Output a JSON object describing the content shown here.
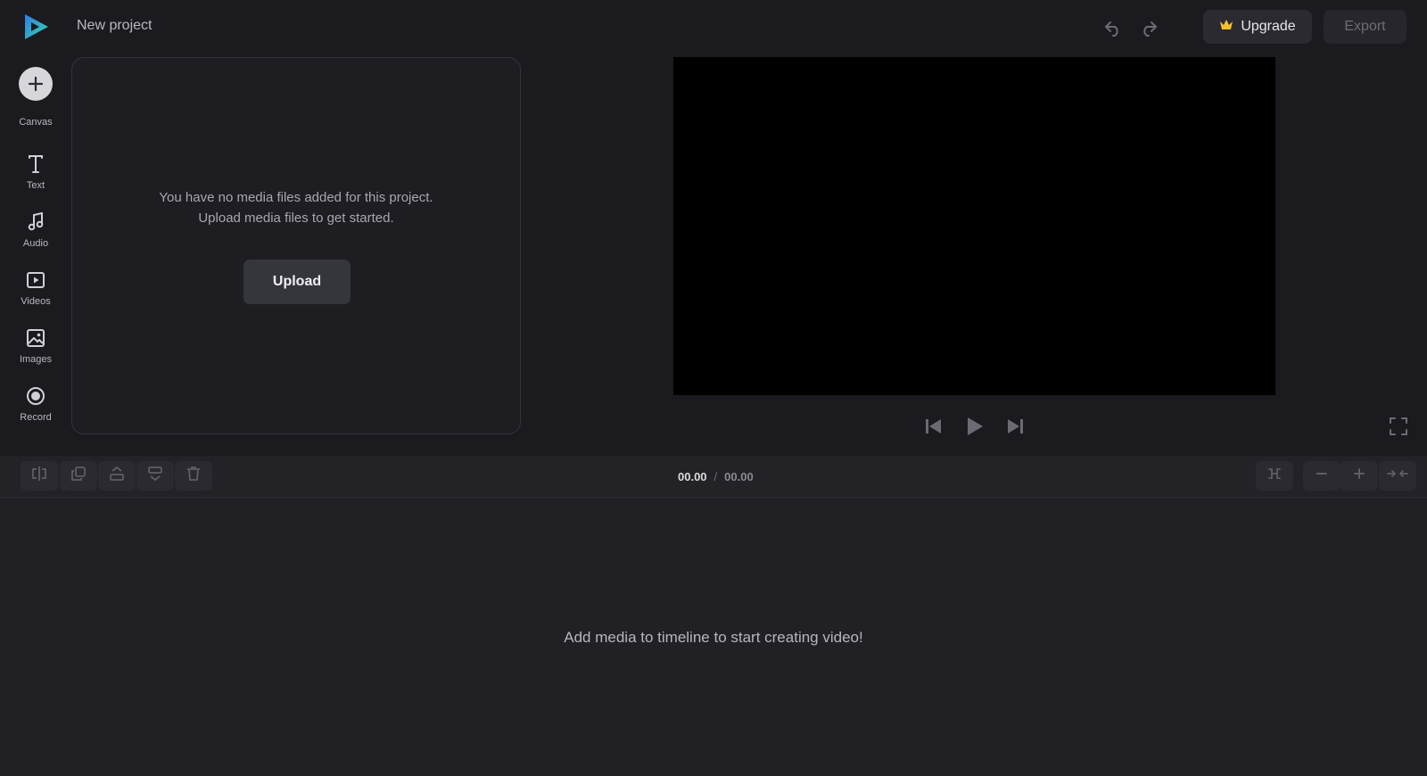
{
  "app": {
    "project_title": "New project",
    "brand_color": "#2fc0d8",
    "accent_color": "#f2c12e"
  },
  "header": {
    "undo_icon": "undo-icon",
    "redo_icon": "redo-icon",
    "upgrade_label": "Upgrade",
    "upgrade_icon": "crown-icon",
    "export_label": "Export"
  },
  "sidebar": {
    "items": [
      {
        "label": "Canvas",
        "icon": "plus-icon"
      },
      {
        "label": "Text",
        "icon": "text-icon"
      },
      {
        "label": "Audio",
        "icon": "music-note-icon"
      },
      {
        "label": "Videos",
        "icon": "video-icon"
      },
      {
        "label": "Images",
        "icon": "image-icon"
      },
      {
        "label": "Record",
        "icon": "record-icon"
      }
    ]
  },
  "media_panel": {
    "empty_line1": "You have no media files added for this project.",
    "empty_line2": "Upload media files to get started.",
    "upload_label": "Upload"
  },
  "player": {
    "current_time": "00.00",
    "separator": "/",
    "total_time": "00.00"
  },
  "timeline": {
    "empty_message": "Add media to timeline to start creating video!"
  }
}
